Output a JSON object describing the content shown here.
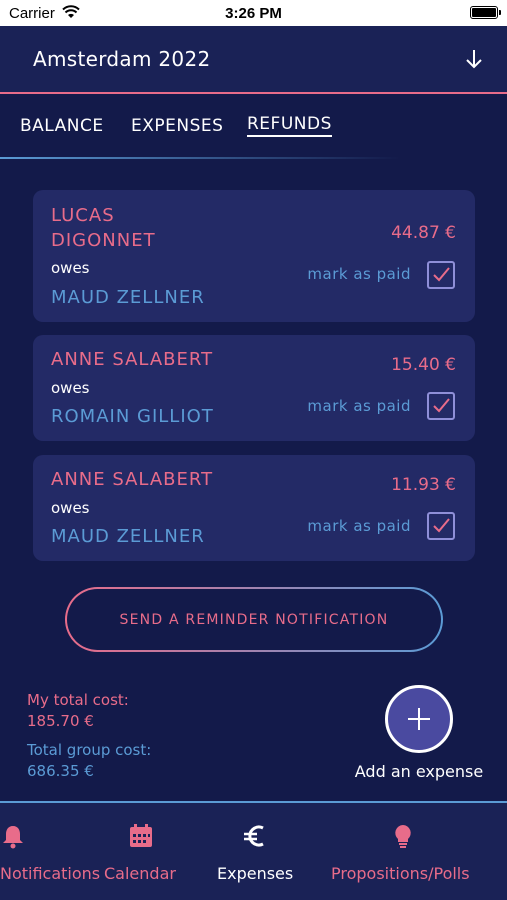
{
  "status_bar": {
    "carrier": "Carrier",
    "time": "3:26 PM"
  },
  "header": {
    "title": "Amsterdam 2022"
  },
  "tabs": [
    {
      "label": "BALANCE",
      "active": false
    },
    {
      "label": "EXPENSES",
      "active": false
    },
    {
      "label": "REFUNDS",
      "active": true
    }
  ],
  "refunds": [
    {
      "debtor": "LUCAS DIGONNET",
      "owes": "owes",
      "creditor": "MAUD ZELLNER",
      "amount": "44.87 €",
      "mark_label": "mark as paid",
      "paid": true
    },
    {
      "debtor": "ANNE SALABERT",
      "owes": "owes",
      "creditor": "ROMAIN GILLIOT",
      "amount": "15.40 €",
      "mark_label": "mark as paid",
      "paid": true
    },
    {
      "debtor": "ANNE SALABERT",
      "owes": "owes",
      "creditor": "MAUD ZELLNER",
      "amount": "11.93 €",
      "mark_label": "mark as paid",
      "paid": true
    }
  ],
  "reminder_button": {
    "label": "SEND A REMINDER NOTIFICATION"
  },
  "totals": {
    "my_label": "My total cost:",
    "my_value": "185.70 €",
    "group_label": "Total group cost:",
    "group_value": "686.35 €"
  },
  "fab": {
    "label": "Add an expense",
    "icon": "plus-icon"
  },
  "bottom_nav": [
    {
      "label": "Notifications",
      "icon": "bell-icon",
      "active": false
    },
    {
      "label": "Calendar",
      "icon": "calendar-icon",
      "active": false
    },
    {
      "label": "Expenses",
      "icon": "euro-icon",
      "active": true
    },
    {
      "label": "Propositions/Polls",
      "icon": "lightbulb-icon",
      "active": false
    }
  ],
  "colors": {
    "background": "#131a4a",
    "card": "#232a66",
    "pink": "#e86c8a",
    "blue": "#5b9bd5",
    "fab": "#4a4aa0"
  }
}
